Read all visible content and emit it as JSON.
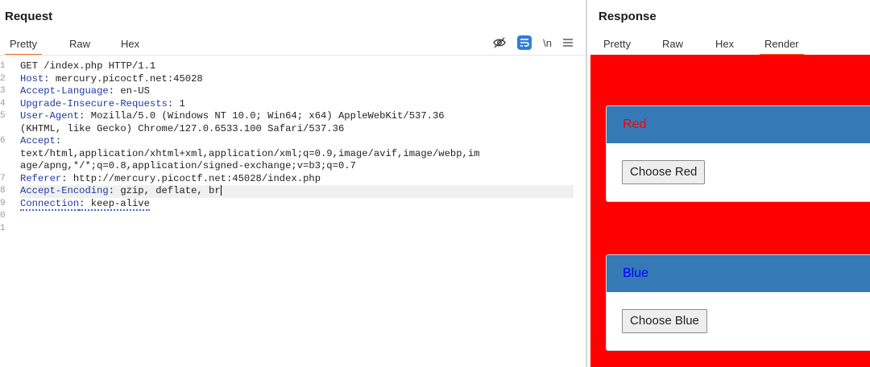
{
  "request": {
    "title": "Request",
    "tabs": [
      "Pretty",
      "Raw",
      "Hex"
    ],
    "active_tab": "Pretty",
    "tools": {
      "hide_icon": "eye-slash-icon",
      "wrap_icon": "wrap-icon",
      "newline_label": "\\n",
      "menu_icon": "hamburger-icon"
    },
    "lines": [
      {
        "num": "1",
        "parts": [
          {
            "t": "GET /index.php HTTP/1.1",
            "c": "plain"
          }
        ]
      },
      {
        "num": "2",
        "parts": [
          {
            "t": "Host",
            "c": "hname"
          },
          {
            "t": ": mercury.picoctf.net:45028",
            "c": "plain"
          }
        ]
      },
      {
        "num": "3",
        "parts": [
          {
            "t": "Accept-Language",
            "c": "hname"
          },
          {
            "t": ": en-US",
            "c": "plain"
          }
        ]
      },
      {
        "num": "4",
        "parts": [
          {
            "t": "Upgrade-Insecure-Requests",
            "c": "hname"
          },
          {
            "t": ": 1",
            "c": "plain"
          }
        ]
      },
      {
        "num": "5",
        "parts": [
          {
            "t": "User-Agent",
            "c": "hname"
          },
          {
            "t": ": Mozilla/5.0 (Windows NT 10.0; Win64; x64) AppleWebKit/537.36",
            "c": "plain"
          }
        ]
      },
      {
        "num": "",
        "parts": [
          {
            "t": "(KHTML, like Gecko) Chrome/127.0.6533.100 Safari/537.36",
            "c": "plain"
          }
        ]
      },
      {
        "num": "6",
        "parts": [
          {
            "t": "Accept",
            "c": "hname"
          },
          {
            "t": ":",
            "c": "plain"
          }
        ]
      },
      {
        "num": "",
        "parts": [
          {
            "t": "text/html,application/xhtml+xml,application/xml;q=0.9,image/avif,image/webp,im",
            "c": "plain"
          }
        ]
      },
      {
        "num": "",
        "parts": [
          {
            "t": "age/apng,*/*;q=0.8,application/signed-exchange;v=b3;q=0.7",
            "c": "plain"
          }
        ]
      },
      {
        "num": "7",
        "parts": [
          {
            "t": "Referer",
            "c": "hname"
          },
          {
            "t": ": http://mercury.picoctf.net:45028/index.php",
            "c": "plain"
          }
        ]
      },
      {
        "num": "8",
        "parts": [
          {
            "t": "Accept-Encoding",
            "c": "hname"
          },
          {
            "t": ": gzip, deflate, br",
            "c": "plain"
          }
        ],
        "highlight": true,
        "cursor": true
      },
      {
        "num": "9",
        "parts": [
          {
            "t": "Connection",
            "c": "hname dotted"
          },
          {
            "t": ": keep-alive",
            "c": "plain dotted"
          }
        ]
      },
      {
        "num": "0",
        "parts": []
      },
      {
        "num": "1",
        "parts": []
      }
    ]
  },
  "response": {
    "title": "Response",
    "tabs": [
      "Pretty",
      "Raw",
      "Hex",
      "Render"
    ],
    "active_tab": "Render",
    "render": {
      "background": "#ff0000",
      "cards": [
        {
          "heading": "Red",
          "heading_color": "#ff0000",
          "header_bg": "#357ab7",
          "button": "Choose Red"
        },
        {
          "heading": "Blue",
          "heading_color": "#0000ff",
          "header_bg": "#357ab7",
          "button": "Choose Blue"
        }
      ]
    }
  },
  "colors": {
    "accent": "#e86b2b",
    "header_name": "#1f3aa0",
    "wrap_button": "#2f7fd6"
  }
}
